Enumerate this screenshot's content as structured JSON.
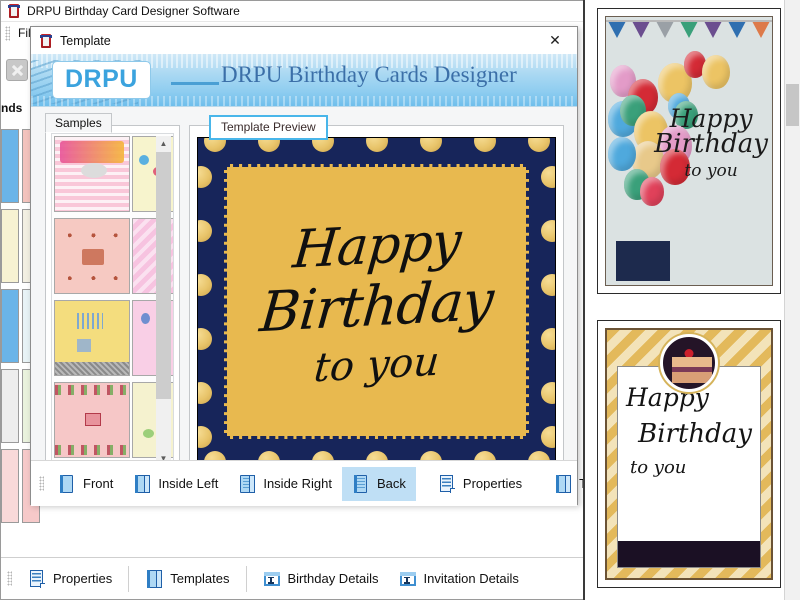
{
  "main_window": {
    "title": "DRPU Birthday Card Designer Software",
    "app_icon": "drpu-app-icon",
    "menu": {
      "file_label": "File"
    },
    "side_tab_label": "nds"
  },
  "dialog": {
    "title": "Template",
    "icon": "drpu-app-icon",
    "close_label": "✕",
    "banner": {
      "logo_text": "DRPU",
      "title": "DRPU Birthday Cards Designer"
    },
    "samples": {
      "tab_label": "Samples",
      "scroll_up": "▲",
      "scroll_down": "▼",
      "thumbnails": [
        {
          "name": "pink-happy-birthday-stripes",
          "bg": "#f9c7d8",
          "accent": "#e8559a"
        },
        {
          "name": "cream-confetti-party",
          "bg": "#f7f4cd",
          "accent": "#5ab0e0"
        },
        {
          "name": "pink-cake-floral",
          "bg": "#f6c9c2",
          "accent": "#a4543a"
        },
        {
          "name": "pink-swirl-pattern",
          "bg": "#f7c3e0",
          "accent": "#e06fb0"
        },
        {
          "name": "yellow-gift-celebration",
          "bg": "#f4dd7e",
          "accent": "#7a7a7a"
        },
        {
          "name": "pink-balloons-light",
          "bg": "#f9cfe6",
          "accent": "#f0f0c0"
        },
        {
          "name": "pink-cake-border",
          "bg": "#f6c7c7",
          "accent": "#b33a4a"
        },
        {
          "name": "cream-light-confetti",
          "bg": "#f5f2cf",
          "accent": "#9ccf7a"
        }
      ]
    },
    "preview": {
      "legend": "Template Preview",
      "card": {
        "name": "navy-gold-dots-birthday-card",
        "border_color": "#17255a",
        "panel_color": "#e8b94f",
        "dot_color": "#e8c46a",
        "lines": [
          "Happy",
          "Birthday",
          "to you"
        ]
      }
    },
    "toolbar": {
      "items": [
        {
          "label": "Front",
          "icon": "card-front-icon",
          "selected": false
        },
        {
          "label": "Inside Left",
          "icon": "card-inside-left-icon",
          "selected": false
        },
        {
          "label": "Inside Right",
          "icon": "card-inside-right-icon",
          "selected": false
        },
        {
          "label": "Back",
          "icon": "card-back-icon",
          "selected": true
        },
        {
          "label": "Properties",
          "icon": "properties-icon",
          "selected": false
        },
        {
          "label": "Templates",
          "icon": "templates-icon",
          "selected": false
        }
      ]
    }
  },
  "app_toolbar": {
    "items": [
      {
        "label": "Properties",
        "icon": "properties-icon"
      },
      {
        "label": "Templates",
        "icon": "templates-icon"
      },
      {
        "label": "Birthday Details",
        "icon": "birthday-details-icon"
      },
      {
        "label": "Invitation Details",
        "icon": "invitation-details-icon"
      }
    ]
  },
  "right_panel": {
    "cards": [
      {
        "name": "balloons-bunting-card",
        "lines": [
          "Happy",
          "Birthday",
          "to you"
        ],
        "bg": "#dbe2e2",
        "box_color": "#1d2a4d"
      },
      {
        "name": "gold-chevron-cake-card",
        "lines": [
          "Happy",
          "Birthday",
          "to you"
        ],
        "chevron_color": "#e2b653",
        "band_color": "#1b1024"
      }
    ]
  },
  "colors": {
    "accent_blue": "#3ba3de",
    "banner_title": "#3b6fa8",
    "selection": "#bfdff5",
    "legend_outline": "#49b6ea",
    "card_navy": "#17255a",
    "card_gold": "#e8b94f"
  }
}
